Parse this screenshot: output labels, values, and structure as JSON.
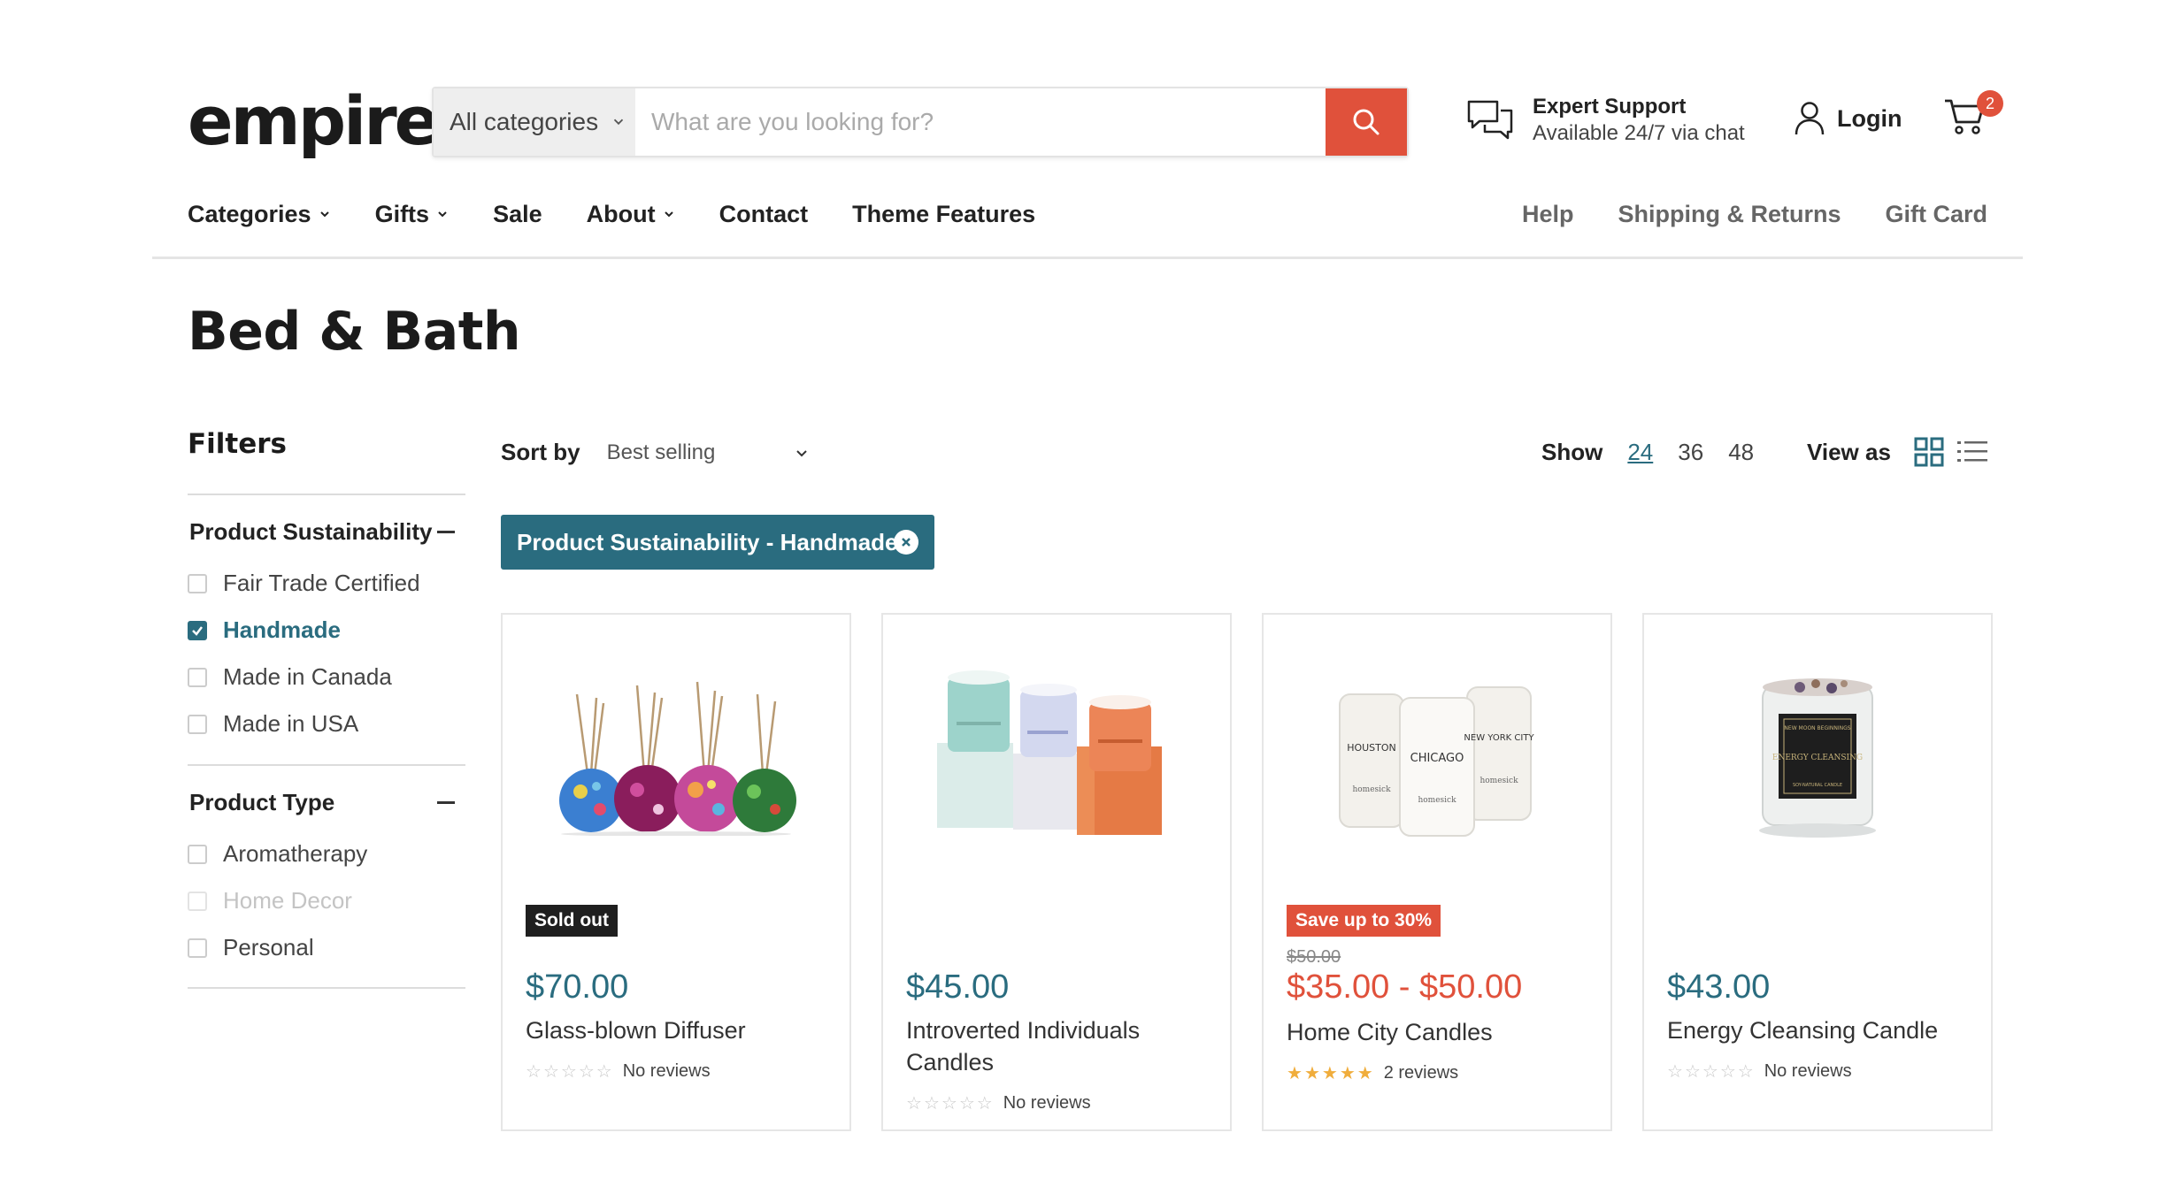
{
  "brand": {
    "logo_text": "empire",
    "accent": "#e0513b",
    "primary": "#2a6c7f"
  },
  "search": {
    "category": "All categories",
    "placeholder": "What are you looking for?",
    "icon": "search-icon"
  },
  "support": {
    "title": "Expert Support",
    "subtitle": "Available 24/7 via chat",
    "icon": "chat-bubbles-icon"
  },
  "account": {
    "login_label": "Login",
    "icon": "user-icon"
  },
  "cart": {
    "count": "2",
    "icon": "cart-icon"
  },
  "nav": {
    "left": [
      {
        "label": "Categories",
        "dropdown": true
      },
      {
        "label": "Gifts",
        "dropdown": true
      },
      {
        "label": "Sale",
        "dropdown": false
      },
      {
        "label": "About",
        "dropdown": true
      },
      {
        "label": "Contact",
        "dropdown": false
      },
      {
        "label": "Theme Features",
        "dropdown": false
      }
    ],
    "right": [
      {
        "label": "Help"
      },
      {
        "label": "Shipping & Returns"
      },
      {
        "label": "Gift Card"
      }
    ]
  },
  "page": {
    "title": "Bed & Bath"
  },
  "filters": {
    "title": "Filters",
    "groups": [
      {
        "title": "Product Sustainability",
        "options": [
          {
            "label": "Fair Trade Certified",
            "checked": false,
            "disabled": false
          },
          {
            "label": "Handmade",
            "checked": true,
            "disabled": false
          },
          {
            "label": "Made in Canada",
            "checked": false,
            "disabled": false
          },
          {
            "label": "Made in USA",
            "checked": false,
            "disabled": false
          }
        ]
      },
      {
        "title": "Product Type",
        "options": [
          {
            "label": "Aromatherapy",
            "checked": false,
            "disabled": false
          },
          {
            "label": "Home Decor",
            "checked": false,
            "disabled": true
          },
          {
            "label": "Personal",
            "checked": false,
            "disabled": false
          }
        ]
      }
    ]
  },
  "toolbar": {
    "sort_label": "Sort by",
    "sort_value": "Best selling",
    "show_label": "Show",
    "show_options": [
      "24",
      "36",
      "48"
    ],
    "show_selected": "24",
    "view_label": "View as"
  },
  "active_filter": {
    "label": "Product Sustainability - Handmade"
  },
  "products": [
    {
      "badge": "Sold out",
      "old_price": "",
      "price": "$70.00",
      "title": "Glass-blown Diffuser",
      "reviews": "No reviews",
      "rating": 0
    },
    {
      "badge": "",
      "old_price": "",
      "price": "$45.00",
      "title": "Introverted Individuals Candles",
      "reviews": "No reviews",
      "rating": 0
    },
    {
      "badge": "Save up to 30%",
      "old_price": "$50.00",
      "price": "$35.00 - $50.00",
      "title": "Home City Candles",
      "reviews": "2 reviews",
      "rating": 5
    },
    {
      "badge": "",
      "old_price": "",
      "price": "$43.00",
      "title": "Energy Cleansing Candle",
      "reviews": "No reviews",
      "rating": 0
    }
  ],
  "product_image_labels": {
    "home_city": [
      "HOUSTON",
      "CHICAGO",
      "NEW YORK CITY",
      "homesick"
    ],
    "energy": [
      "NEW MOON BEGINNINGS",
      "ENERGY CLEANSING",
      "SOY-NATURAL CANDLE"
    ]
  }
}
